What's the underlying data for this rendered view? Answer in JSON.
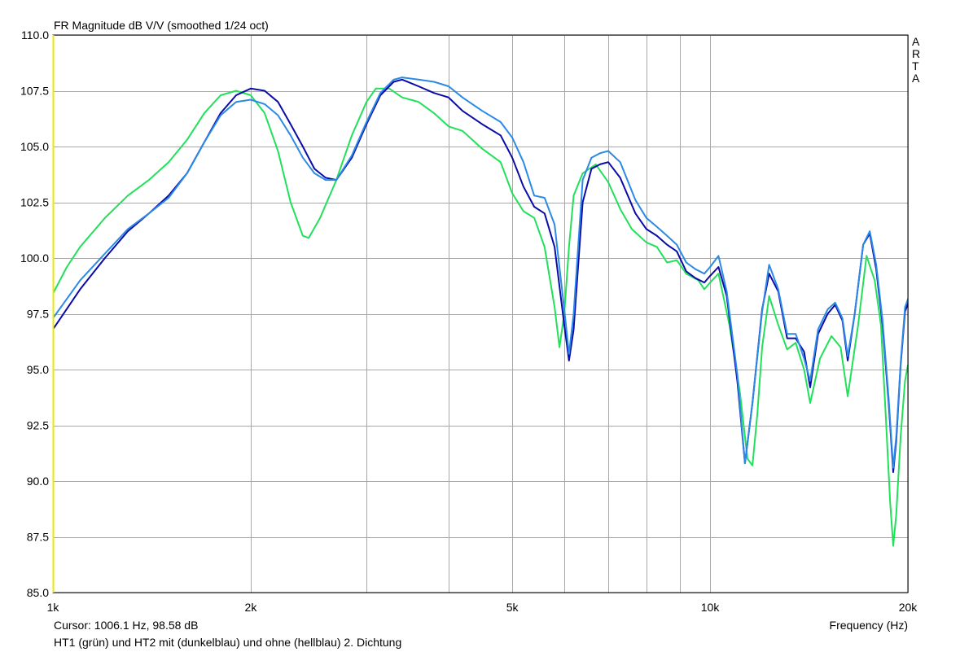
{
  "chart_data": {
    "type": "line",
    "title": "FR Magnitude dB V/V (smoothed 1/24 oct)",
    "brand": "ARTA",
    "xlabel": "Frequency (Hz)",
    "ylabel": "",
    "x_scale": "log",
    "xlim": [
      1000,
      20000
    ],
    "ylim": [
      85,
      110
    ],
    "grid": true,
    "y_ticks": [
      {
        "value": 85,
        "label": "85.0"
      },
      {
        "value": 87.5,
        "label": "87.5"
      },
      {
        "value": 90,
        "label": "90.0"
      },
      {
        "value": 92.5,
        "label": "92.5"
      },
      {
        "value": 95,
        "label": "95.0"
      },
      {
        "value": 97.5,
        "label": "97.5"
      },
      {
        "value": 100,
        "label": "100.0"
      },
      {
        "value": 102.5,
        "label": "102.5"
      },
      {
        "value": 105,
        "label": "105.0"
      },
      {
        "value": 107.5,
        "label": "107.5"
      },
      {
        "value": 110,
        "label": "110.0"
      }
    ],
    "x_ticks": [
      {
        "value": 1000,
        "label": "1k"
      },
      {
        "value": 2000,
        "label": "2k"
      },
      {
        "value": 5000,
        "label": "5k"
      },
      {
        "value": 10000,
        "label": "10k"
      },
      {
        "value": 20000,
        "label": "20k"
      }
    ],
    "x_gridlines": [
      1000,
      2000,
      3000,
      4000,
      5000,
      6000,
      7000,
      8000,
      9000,
      10000,
      20000
    ],
    "cursor_text": "Cursor: 1006.1 Hz, 98.58 dB",
    "caption": "HT1 (grün) und HT2 mit (dunkelblau) und ohne (hellblau) 2. Dichtung",
    "series": [
      {
        "color": "#22e05a",
        "points": [
          [
            1000,
            98.4
          ],
          [
            1050,
            99.6
          ],
          [
            1100,
            100.5
          ],
          [
            1200,
            101.8
          ],
          [
            1300,
            102.8
          ],
          [
            1400,
            103.5
          ],
          [
            1500,
            104.3
          ],
          [
            1600,
            105.3
          ],
          [
            1700,
            106.5
          ],
          [
            1800,
            107.3
          ],
          [
            1900,
            107.5
          ],
          [
            2000,
            107.3
          ],
          [
            2100,
            106.5
          ],
          [
            2200,
            104.8
          ],
          [
            2300,
            102.5
          ],
          [
            2400,
            101.0
          ],
          [
            2450,
            100.9
          ],
          [
            2550,
            101.8
          ],
          [
            2700,
            103.5
          ],
          [
            2850,
            105.5
          ],
          [
            3000,
            107.0
          ],
          [
            3100,
            107.6
          ],
          [
            3250,
            107.6
          ],
          [
            3400,
            107.2
          ],
          [
            3600,
            107.0
          ],
          [
            3800,
            106.5
          ],
          [
            4000,
            105.9
          ],
          [
            4200,
            105.7
          ],
          [
            4500,
            104.9
          ],
          [
            4800,
            104.3
          ],
          [
            5000,
            102.9
          ],
          [
            5200,
            102.1
          ],
          [
            5400,
            101.8
          ],
          [
            5600,
            100.5
          ],
          [
            5800,
            97.8
          ],
          [
            5900,
            96.0
          ],
          [
            6000,
            97.5
          ],
          [
            6100,
            100.5
          ],
          [
            6200,
            102.8
          ],
          [
            6400,
            103.8
          ],
          [
            6700,
            104.2
          ],
          [
            7000,
            103.4
          ],
          [
            7300,
            102.2
          ],
          [
            7600,
            101.3
          ],
          [
            8000,
            100.7
          ],
          [
            8300,
            100.5
          ],
          [
            8600,
            99.8
          ],
          [
            8900,
            99.9
          ],
          [
            9200,
            99.3
          ],
          [
            9600,
            99.0
          ],
          [
            9800,
            98.6
          ],
          [
            10000,
            98.9
          ],
          [
            10300,
            99.3
          ],
          [
            10700,
            97.0
          ],
          [
            11100,
            94.0
          ],
          [
            11400,
            91.0
          ],
          [
            11600,
            90.7
          ],
          [
            11800,
            93.0
          ],
          [
            12000,
            96.0
          ],
          [
            12300,
            98.3
          ],
          [
            12700,
            97.0
          ],
          [
            13100,
            95.9
          ],
          [
            13500,
            96.2
          ],
          [
            13900,
            95.0
          ],
          [
            14200,
            93.5
          ],
          [
            14700,
            95.5
          ],
          [
            15300,
            96.5
          ],
          [
            15800,
            96.0
          ],
          [
            16200,
            93.8
          ],
          [
            16800,
            97.0
          ],
          [
            17300,
            100.1
          ],
          [
            17800,
            99.0
          ],
          [
            18200,
            97.0
          ],
          [
            18500,
            93.0
          ],
          [
            18800,
            89.0
          ],
          [
            19000,
            87.1
          ],
          [
            19200,
            88.5
          ],
          [
            19500,
            92.0
          ],
          [
            19800,
            94.5
          ],
          [
            20000,
            95.2
          ],
          [
            20300,
            94.8
          ],
          [
            20800,
            93.0
          ],
          [
            21300,
            92.0
          ],
          [
            21800,
            90.0
          ],
          [
            22200,
            90.2
          ],
          [
            22600,
            91.3
          ]
        ]
      },
      {
        "color": "#0a0aa8",
        "points": [
          [
            1000,
            96.8
          ],
          [
            1100,
            98.6
          ],
          [
            1200,
            100.0
          ],
          [
            1300,
            101.2
          ],
          [
            1400,
            102.0
          ],
          [
            1500,
            102.8
          ],
          [
            1600,
            103.8
          ],
          [
            1700,
            105.2
          ],
          [
            1800,
            106.5
          ],
          [
            1900,
            107.3
          ],
          [
            2000,
            107.6
          ],
          [
            2100,
            107.5
          ],
          [
            2200,
            107.0
          ],
          [
            2300,
            106.0
          ],
          [
            2400,
            105.0
          ],
          [
            2500,
            104.0
          ],
          [
            2600,
            103.6
          ],
          [
            2700,
            103.5
          ],
          [
            2850,
            104.5
          ],
          [
            3000,
            106.0
          ],
          [
            3150,
            107.3
          ],
          [
            3300,
            107.9
          ],
          [
            3400,
            108.0
          ],
          [
            3600,
            107.7
          ],
          [
            3800,
            107.4
          ],
          [
            4000,
            107.2
          ],
          [
            4200,
            106.6
          ],
          [
            4500,
            106.0
          ],
          [
            4800,
            105.5
          ],
          [
            5000,
            104.5
          ],
          [
            5200,
            103.2
          ],
          [
            5400,
            102.3
          ],
          [
            5600,
            102.0
          ],
          [
            5800,
            100.5
          ],
          [
            6000,
            97.0
          ],
          [
            6100,
            95.4
          ],
          [
            6200,
            96.8
          ],
          [
            6400,
            102.5
          ],
          [
            6600,
            104.0
          ],
          [
            6800,
            104.2
          ],
          [
            7000,
            104.3
          ],
          [
            7300,
            103.6
          ],
          [
            7700,
            102.0
          ],
          [
            8000,
            101.3
          ],
          [
            8300,
            101.0
          ],
          [
            8600,
            100.6
          ],
          [
            8900,
            100.3
          ],
          [
            9200,
            99.4
          ],
          [
            9500,
            99.1
          ],
          [
            9800,
            98.9
          ],
          [
            10000,
            99.2
          ],
          [
            10300,
            99.6
          ],
          [
            10600,
            98.3
          ],
          [
            11000,
            94.5
          ],
          [
            11300,
            90.8
          ],
          [
            11600,
            93.5
          ],
          [
            12000,
            97.7
          ],
          [
            12300,
            99.3
          ],
          [
            12700,
            98.5
          ],
          [
            13100,
            96.4
          ],
          [
            13500,
            96.4
          ],
          [
            13900,
            95.8
          ],
          [
            14200,
            94.2
          ],
          [
            14600,
            96.6
          ],
          [
            15100,
            97.5
          ],
          [
            15500,
            97.9
          ],
          [
            15900,
            97.2
          ],
          [
            16200,
            95.4
          ],
          [
            16600,
            97.5
          ],
          [
            17100,
            100.6
          ],
          [
            17500,
            101.1
          ],
          [
            17900,
            99.5
          ],
          [
            18300,
            97.0
          ],
          [
            18700,
            93.5
          ],
          [
            19000,
            90.4
          ],
          [
            19200,
            91.8
          ],
          [
            19500,
            95.2
          ],
          [
            19800,
            97.6
          ],
          [
            20200,
            98.3
          ],
          [
            20600,
            96.8
          ],
          [
            21100,
            94.5
          ],
          [
            21600,
            93.0
          ],
          [
            22000,
            92.4
          ],
          [
            22300,
            92.6
          ],
          [
            22600,
            94.3
          ]
        ]
      },
      {
        "color": "#2a8ae6",
        "points": [
          [
            1000,
            97.3
          ],
          [
            1100,
            99.0
          ],
          [
            1200,
            100.2
          ],
          [
            1300,
            101.3
          ],
          [
            1400,
            102.0
          ],
          [
            1500,
            102.7
          ],
          [
            1600,
            103.8
          ],
          [
            1700,
            105.2
          ],
          [
            1800,
            106.4
          ],
          [
            1900,
            107.0
          ],
          [
            2000,
            107.1
          ],
          [
            2100,
            106.9
          ],
          [
            2200,
            106.4
          ],
          [
            2300,
            105.5
          ],
          [
            2400,
            104.5
          ],
          [
            2500,
            103.8
          ],
          [
            2600,
            103.5
          ],
          [
            2700,
            103.5
          ],
          [
            2850,
            104.6
          ],
          [
            3000,
            106.1
          ],
          [
            3150,
            107.4
          ],
          [
            3300,
            108.0
          ],
          [
            3400,
            108.1
          ],
          [
            3600,
            108.0
          ],
          [
            3800,
            107.9
          ],
          [
            4000,
            107.7
          ],
          [
            4200,
            107.2
          ],
          [
            4500,
            106.6
          ],
          [
            4800,
            106.1
          ],
          [
            5000,
            105.4
          ],
          [
            5200,
            104.3
          ],
          [
            5400,
            102.8
          ],
          [
            5600,
            102.7
          ],
          [
            5800,
            101.5
          ],
          [
            6000,
            97.7
          ],
          [
            6100,
            95.7
          ],
          [
            6200,
            97.5
          ],
          [
            6400,
            103.5
          ],
          [
            6600,
            104.5
          ],
          [
            6800,
            104.7
          ],
          [
            7000,
            104.8
          ],
          [
            7300,
            104.3
          ],
          [
            7700,
            102.6
          ],
          [
            8000,
            101.8
          ],
          [
            8300,
            101.4
          ],
          [
            8600,
            101.0
          ],
          [
            8900,
            100.6
          ],
          [
            9200,
            99.8
          ],
          [
            9500,
            99.5
          ],
          [
            9800,
            99.3
          ],
          [
            10000,
            99.6
          ],
          [
            10300,
            100.1
          ],
          [
            10600,
            98.5
          ],
          [
            11000,
            94.8
          ],
          [
            11300,
            90.8
          ],
          [
            11600,
            93.5
          ],
          [
            12000,
            97.6
          ],
          [
            12300,
            99.7
          ],
          [
            12700,
            98.6
          ],
          [
            13100,
            96.6
          ],
          [
            13500,
            96.6
          ],
          [
            13900,
            95.5
          ],
          [
            14200,
            94.5
          ],
          [
            14600,
            96.8
          ],
          [
            15100,
            97.7
          ],
          [
            15500,
            98.0
          ],
          [
            15900,
            97.3
          ],
          [
            16200,
            95.6
          ],
          [
            16600,
            97.5
          ],
          [
            17100,
            100.6
          ],
          [
            17500,
            101.2
          ],
          [
            17900,
            99.7
          ],
          [
            18300,
            97.2
          ],
          [
            18700,
            93.7
          ],
          [
            19000,
            90.6
          ],
          [
            19200,
            92.0
          ],
          [
            19500,
            95.3
          ],
          [
            19800,
            97.8
          ],
          [
            20200,
            98.5
          ],
          [
            20600,
            96.8
          ],
          [
            21100,
            94.0
          ],
          [
            21600,
            92.5
          ],
          [
            22000,
            92.0
          ],
          [
            22300,
            91.6
          ],
          [
            22600,
            91.4
          ]
        ]
      }
    ]
  }
}
